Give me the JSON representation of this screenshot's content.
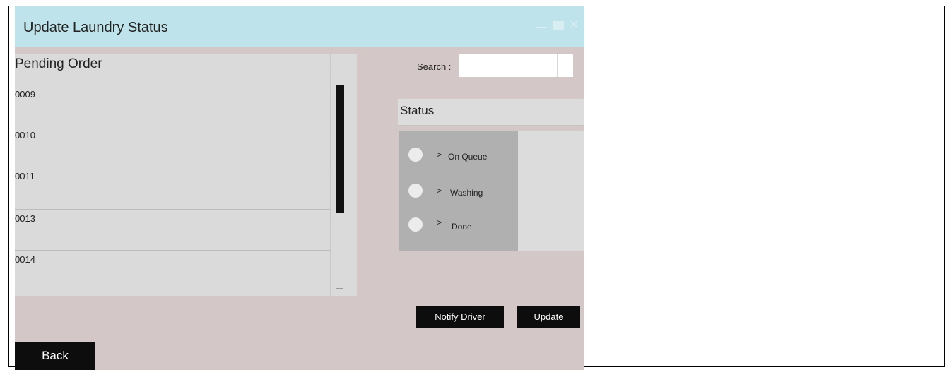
{
  "window": {
    "title": "Update Laundry Status"
  },
  "pending": {
    "title": "Pending Order",
    "orders": [
      "0009",
      "0010",
      "0011",
      "0013",
      "0014"
    ]
  },
  "search": {
    "label": "Search :",
    "value": ""
  },
  "status": {
    "title": "Status",
    "options": [
      {
        "chevron": ">",
        "label": "On Queue"
      },
      {
        "chevron": ">",
        "label": "Washing"
      },
      {
        "chevron": ">",
        "label": "Done"
      }
    ]
  },
  "buttons": {
    "notify_driver": "Notify Driver",
    "update": "Update",
    "back": "Back"
  },
  "colors": {
    "titlebar": "#bfe3eb",
    "window_bg": "#d3c7c7",
    "panel": "#dadada",
    "options_bg": "#b0b0b0",
    "button": "#0d0d0d"
  },
  "icons": [
    "minimize-icon",
    "maximize-icon",
    "close-icon"
  ]
}
